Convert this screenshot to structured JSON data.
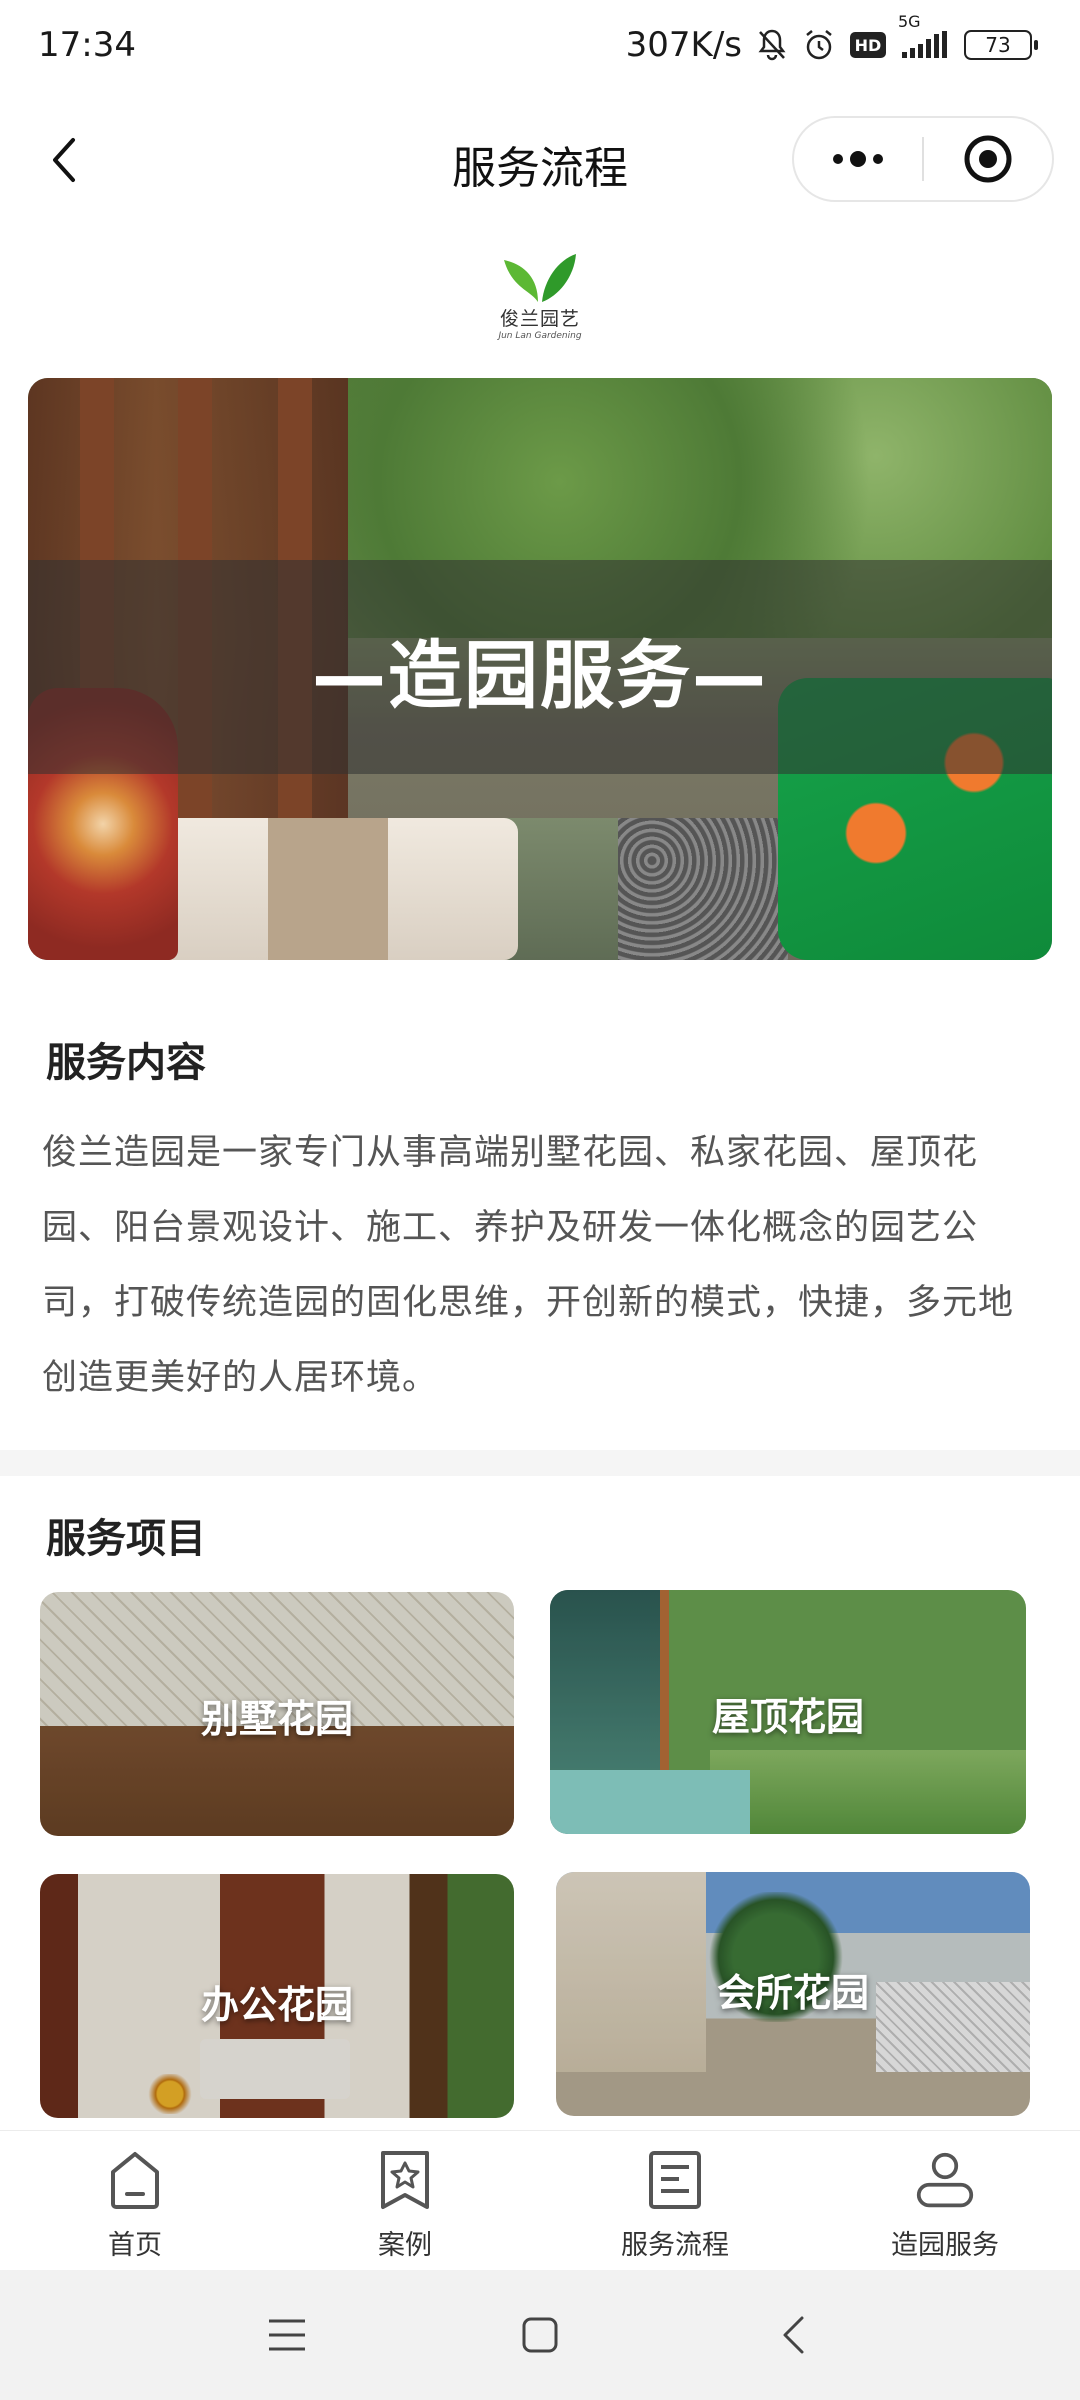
{
  "status_bar": {
    "time": "17:34",
    "network_speed": "307K/s",
    "hd": "HD",
    "signal": "5G",
    "battery": "73"
  },
  "nav": {
    "title": "服务流程"
  },
  "logo": {
    "name": "俊兰园艺",
    "subtitle": "Jun Lan Gardening"
  },
  "banner": {
    "title": "—造园服务—"
  },
  "service_content": {
    "heading": "服务内容",
    "body": "俊兰造园是一家专门从事高端别墅花园、私家花园、屋顶花园、阳台景观设计、施工、养护及研发一体化概念的园艺公司，打破传统造园的固化思维，开创新的模式，快捷，多元地创造更美好的人居环境。"
  },
  "service_items": {
    "heading": "服务项目",
    "cards": [
      {
        "label": "别墅花园"
      },
      {
        "label": "屋顶花园"
      },
      {
        "label": "办公花园"
      },
      {
        "label": "会所花园"
      }
    ]
  },
  "tab_bar": {
    "tabs": [
      {
        "label": "首页",
        "icon": "home-icon"
      },
      {
        "label": "案例",
        "icon": "star-bookmark-icon"
      },
      {
        "label": "服务流程",
        "icon": "document-icon"
      },
      {
        "label": "造园服务",
        "icon": "user-icon"
      }
    ]
  },
  "colors": {
    "accent_green": "#3aa63a",
    "text_primary": "#222222",
    "text_body": "#555555",
    "separator": "#f5f5f5"
  }
}
